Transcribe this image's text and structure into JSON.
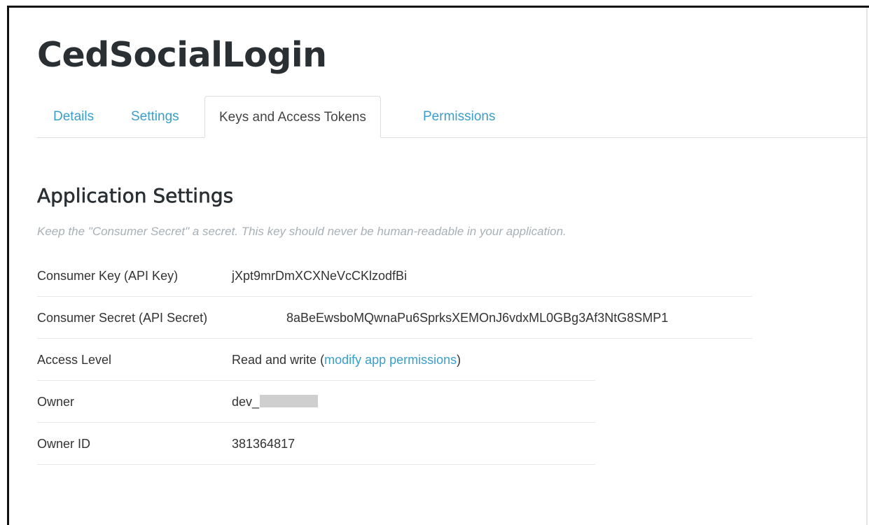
{
  "app": {
    "title": "CedSocialLogin"
  },
  "tabs": [
    {
      "label": "Details",
      "active": false
    },
    {
      "label": "Settings",
      "active": false
    },
    {
      "label": "Keys and Access Tokens",
      "active": true
    },
    {
      "label": "Permissions",
      "active": false
    }
  ],
  "section": {
    "title": "Application Settings",
    "hint": "Keep the \"Consumer Secret\" a secret. This key should never be human-readable in your application."
  },
  "settings": {
    "consumer_key": {
      "label": "Consumer Key (API Key)",
      "value": "jXpt9mrDmXCXNeVcCKlzodfBi"
    },
    "consumer_secret": {
      "label": "Consumer Secret (API Secret)",
      "value": "8aBeEwsboMQwnaPu6SprksXEMOnJ6vdxML0GBg3Af3NtG8SMP1"
    },
    "access_level": {
      "label": "Access Level",
      "value_prefix": "Read and write (",
      "link": "modify app permissions",
      "value_suffix": ")"
    },
    "owner": {
      "label": "Owner",
      "value": "dev_"
    },
    "owner_id": {
      "label": "Owner ID",
      "value": "381364817"
    }
  },
  "colors": {
    "link": "#3a9fc8",
    "title": "#292f33",
    "hint": "#a8b0b5",
    "redaction": "#cfcfcf"
  }
}
